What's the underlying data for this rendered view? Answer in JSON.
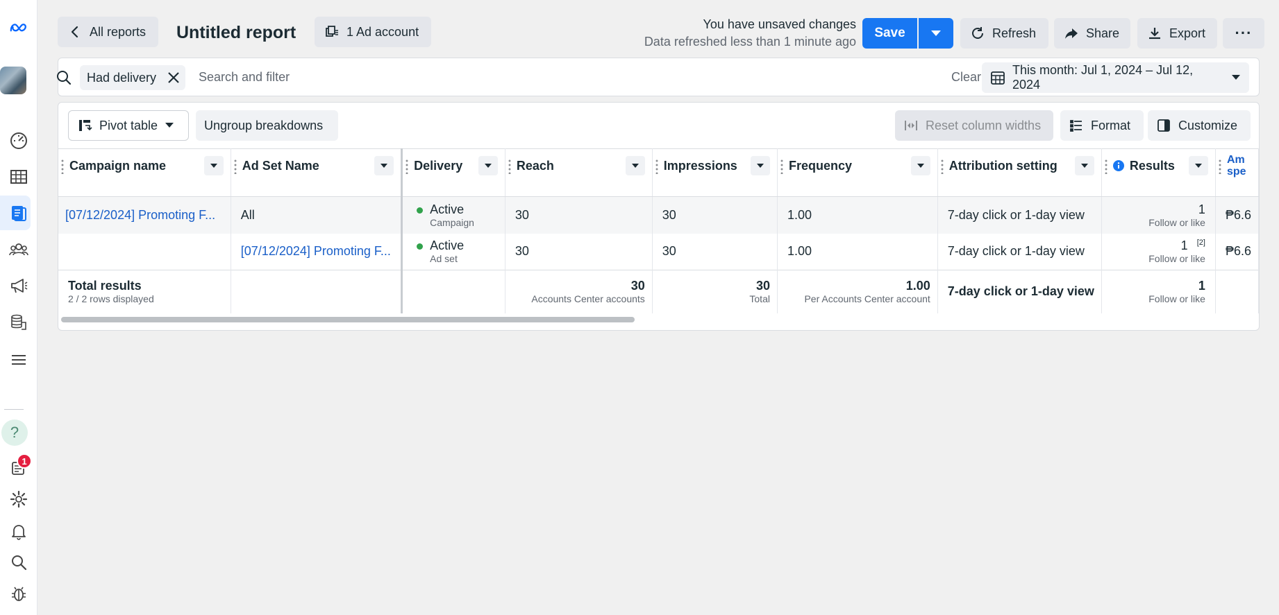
{
  "rail": {
    "items": [
      "meta-logo",
      "avatar",
      "overview",
      "table",
      "reports",
      "audiences",
      "ads",
      "billing",
      "menu",
      "help",
      "notifications-inbox",
      "settings",
      "bell",
      "search",
      "bug"
    ],
    "notification_count": "1",
    "help_glyph": "?"
  },
  "header": {
    "back_label": "All reports",
    "title": "Untitled report",
    "ad_account_label": "1 Ad account",
    "unsaved_text": "You have unsaved changes",
    "refreshed_text": "Data refreshed less than 1 minute ago",
    "save_label": "Save",
    "refresh_label": "Refresh",
    "share_label": "Share",
    "export_label": "Export",
    "more_label": "···"
  },
  "filters": {
    "chip_label": "Had delivery",
    "search_placeholder": "Search and filter",
    "clear_label": "Clear",
    "date_range_label": "This month: Jul 1, 2024 – Jul 12, 2024"
  },
  "toolbar": {
    "pivot_label": "Pivot table",
    "ungroup_label": "Ungroup breakdowns",
    "reset_widths_label": "Reset column widths",
    "format_label": "Format",
    "customize_label": "Customize"
  },
  "table": {
    "columns": [
      "Campaign name",
      "Ad Set Name",
      "Delivery",
      "Reach",
      "Impressions",
      "Frequency",
      "Attribution setting",
      "Results",
      "Am spe"
    ],
    "rows": [
      {
        "campaign": "[07/12/2024] Promoting F...",
        "adset": "All",
        "delivery": "Active",
        "delivery_sub": "Campaign",
        "reach": "30",
        "impressions": "30",
        "frequency": "1.00",
        "attribution": "7-day click or 1-day view",
        "results": "1",
        "results_sub": "Follow or like",
        "amount": "₱6.6"
      },
      {
        "campaign": "",
        "adset": "[07/12/2024] Promoting F...",
        "delivery": "Active",
        "delivery_sub": "Ad set",
        "reach": "30",
        "impressions": "30",
        "frequency": "1.00",
        "attribution": "7-day click or 1-day view",
        "results": "1",
        "results_note": "[2]",
        "results_sub": "Follow or like",
        "amount": "₱6.6"
      }
    ],
    "total": {
      "label": "Total results",
      "sub": "2 / 2 rows displayed",
      "reach": "30",
      "reach_sub": "Accounts Center accounts",
      "impressions": "30",
      "impressions_sub": "Total",
      "frequency": "1.00",
      "frequency_sub": "Per Accounts Center account",
      "attribution": "7-day click or 1-day view",
      "results": "1",
      "results_sub": "Follow or like"
    }
  },
  "colors": {
    "primary": "#1877f2",
    "link": "#1a5fc8",
    "active_dot": "#31a24c",
    "badge": "#e41e3f"
  }
}
